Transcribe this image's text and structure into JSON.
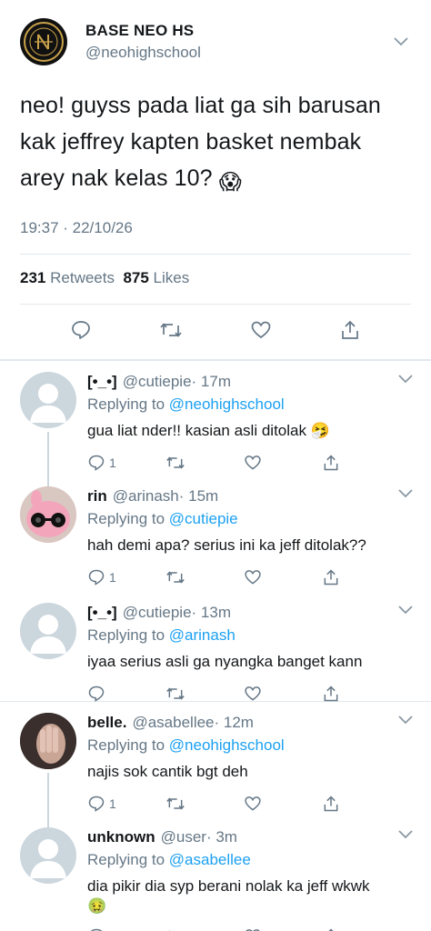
{
  "main": {
    "name": "BASE NEO HS",
    "handle": "@neohighschool",
    "text": "neo! guyss pada liat ga sih barusan kak jeffrey kapten basket nembak arey nak kelas 10?",
    "emoji": "😱",
    "timestamp": "19:37 · 22/10/26",
    "retweets": "231",
    "retweets_label": "Retweets",
    "likes": "875",
    "likes_label": "Likes"
  },
  "replies": [
    {
      "name": "[•_•]",
      "handle": "@cutiepie",
      "time": "· 17m",
      "replying_prefix": "Replying to ",
      "replying_to": "@neohighschool",
      "text": "gua liat nder!! kasian asli ditolak",
      "emoji": "🤧",
      "reply_count": "1"
    },
    {
      "name": "rin",
      "handle": "@arinash",
      "time": "· 15m",
      "replying_prefix": "Replying to ",
      "replying_to": "@cutiepie",
      "text": "hah demi apa? serius ini ka jeff ditolak??",
      "emoji": "",
      "reply_count": "1"
    },
    {
      "name": "[•_•]",
      "handle": "@cutiepie",
      "time": "· 13m",
      "replying_prefix": "Replying to ",
      "replying_to": "@arinash",
      "text": "iyaa serius asli ga nyangka banget kann",
      "emoji": "",
      "reply_count": ""
    },
    {
      "name": "belle.",
      "handle": "@asabellee",
      "time": "· 12m",
      "replying_prefix": "Replying to ",
      "replying_to": "@neohighschool",
      "text": "najis sok cantik bgt deh",
      "emoji": "",
      "reply_count": "1"
    },
    {
      "name": "unknown",
      "handle": "@user",
      "time": "· 3m",
      "replying_prefix": "Replying to ",
      "replying_to": "@asabellee",
      "text": "dia pikir dia syp berani nolak ka jeff wkwk",
      "emoji": "🤢",
      "reply_count": ""
    }
  ],
  "colors": {
    "accent": "#1da1f2",
    "muted": "#657786",
    "divider": "#e1e8ed",
    "placeholder": "#ccd6dd"
  },
  "icons": [
    "logo-crest-icon",
    "chevron-down-icon",
    "reply-icon",
    "retweet-icon",
    "like-icon",
    "share-icon"
  ]
}
